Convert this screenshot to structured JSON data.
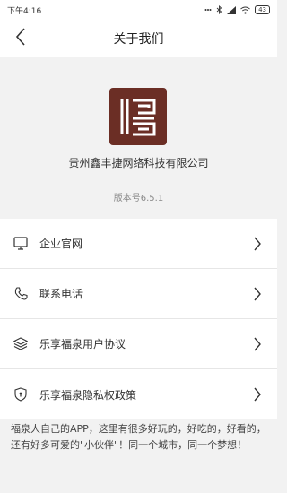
{
  "status_bar": {
    "time": "下午4:16",
    "battery": "43",
    "icons": [
      "dots-icon",
      "bluetooth-icon",
      "signal-icon",
      "wifi-icon",
      "battery-icon"
    ]
  },
  "nav": {
    "title": "关于我们",
    "back_icon": "back-arrow-icon"
  },
  "about": {
    "company_name": "贵州鑫丰捷网络科技有限公司",
    "version": "版本号6.5.1",
    "logo_color": "#6b2e25"
  },
  "menu": {
    "items": [
      {
        "label": "企业官网",
        "icon": "monitor-icon"
      },
      {
        "label": "联系电话",
        "icon": "phone-icon"
      },
      {
        "label": "乐享福泉用户协议",
        "icon": "layers-icon"
      },
      {
        "label": "乐享福泉隐私权政策",
        "icon": "shield-icon"
      }
    ]
  },
  "footer": {
    "text": "福泉人自己的APP，这里有很多好玩的，好吃的，好看的，还有好多可爱的\"小伙伴\"！同一个城市，同一个梦想！"
  }
}
